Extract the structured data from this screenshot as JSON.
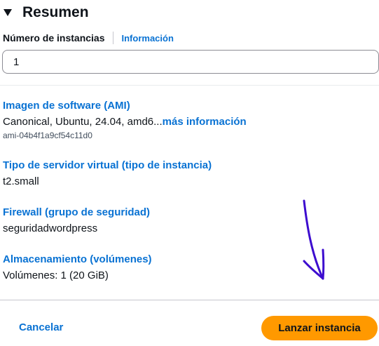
{
  "header": {
    "title": "Resumen",
    "caret_icon": "caret-down-icon"
  },
  "instances": {
    "label": "Número de instancias",
    "info_link": "Información",
    "value": "1"
  },
  "ami": {
    "title": "Imagen de software (AMI)",
    "description": "Canonical, Ubuntu, 24.04, amd6...",
    "more_link": "más información",
    "id": "ami-04b4f1a9cf54c11d0"
  },
  "instance_type": {
    "title": "Tipo de servidor virtual (tipo de instancia)",
    "value": "t2.small"
  },
  "firewall": {
    "title": "Firewall (grupo de seguridad)",
    "value": "seguridadwordpress"
  },
  "storage": {
    "title": "Almacenamiento (volúmenes)",
    "value": "Volúmenes: 1 (20 GiB)"
  },
  "footer": {
    "cancel_label": "Cancelar",
    "launch_label": "Lanzar instancia"
  },
  "colors": {
    "link": "#0972d3",
    "primary_button": "#ff9900",
    "annotation": "#3d0ccf"
  }
}
